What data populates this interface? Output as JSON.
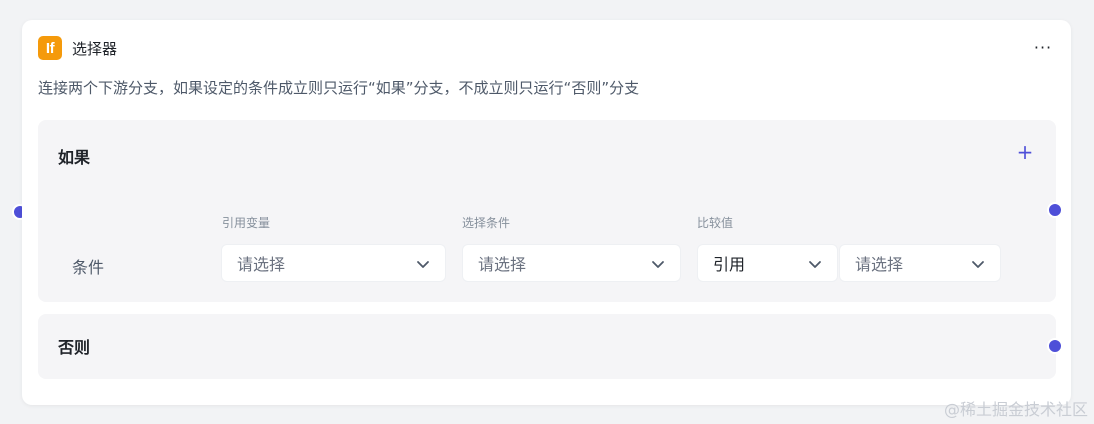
{
  "node": {
    "badge": "If",
    "title": "选择器",
    "more": "···",
    "description": "连接两个下游分支，如果设定的条件成立则只运行“如果”分支，不成立则只运行“否则”分支"
  },
  "branch_if": {
    "title": "如果",
    "add": "+",
    "condition_label": "条件",
    "fields": {
      "ref_var_label": "引用变量",
      "ref_var_placeholder": "请选择",
      "cond_label": "选择条件",
      "cond_placeholder": "请选择",
      "compare_label": "比较值",
      "compare_type_value": "引用",
      "compare_value_placeholder": "请选择"
    }
  },
  "branch_else": {
    "title": "否则"
  },
  "watermark": "@稀土掘金技术社区",
  "colors": {
    "accent": "#4e4fd8",
    "badge": "#f59a0b",
    "panel": "#f5f5f7"
  }
}
